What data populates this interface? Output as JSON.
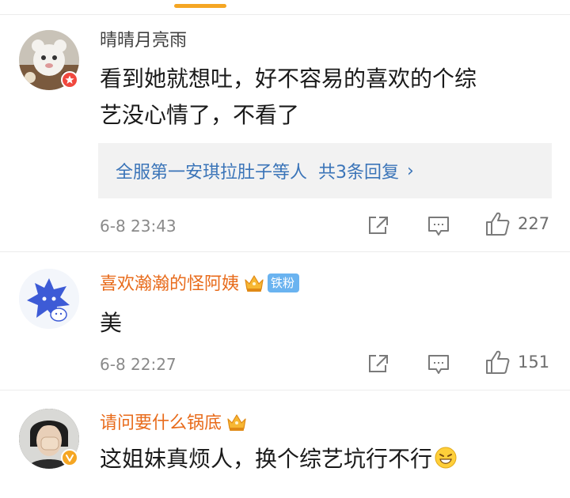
{
  "comments": [
    {
      "username": "晴晴月亮雨",
      "text_lines": [
        "看到她就想吐，好不容易的喜欢的个综",
        "艺没心情了，不看了"
      ],
      "reply": {
        "names": "全服第一安琪拉肚子等人",
        "count": "共3条回复",
        "chevron": "›"
      },
      "time": "6-8 23:43",
      "likes": "227"
    },
    {
      "username": "喜欢瀚瀚的怪阿姨",
      "fan_badge": "铁粉",
      "text_lines": [
        "美"
      ],
      "time": "6-8 22:27",
      "likes": "151"
    },
    {
      "username": "请问要什么锅底",
      "text_lines": [
        "这姐妹真烦人，换个综艺坑行不行"
      ]
    }
  ],
  "colors": {
    "accent": "#f5a623",
    "username_vip": "#e86b1b",
    "reply_link": "#3a74b8",
    "meta_gray": "#8a8a8a",
    "fan_badge_bg": "#6ab3f0"
  },
  "icons": {
    "share": "share-icon",
    "comment": "comment-icon",
    "like": "like-icon",
    "crown": "crown-icon",
    "verified": "verified-icon",
    "emoji": "grin-emoji-icon"
  }
}
